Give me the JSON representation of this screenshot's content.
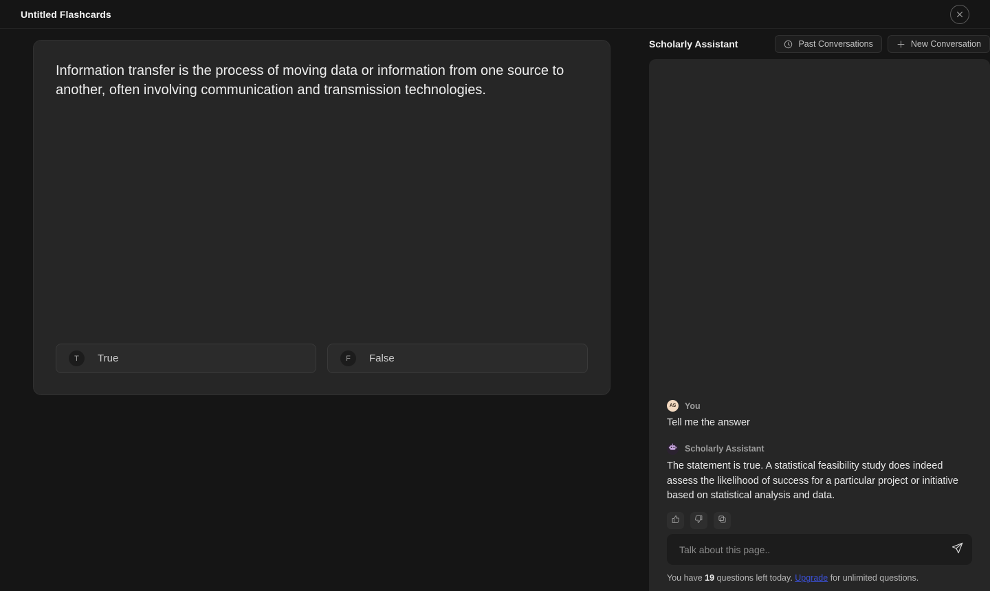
{
  "topbar": {
    "title": "Untitled Flashcards",
    "close_icon": "close-circle-icon"
  },
  "flashcard": {
    "question": "Information transfer is the process of moving data or information from one source to another, often involving communication and transmission technologies.",
    "answers": [
      {
        "key": "T",
        "label": "True"
      },
      {
        "key": "F",
        "label": "False"
      }
    ]
  },
  "chat": {
    "title": "Scholarly Assistant",
    "header_buttons": [
      {
        "label": "Past Conversations",
        "icon": "clock-icon"
      },
      {
        "label": "New Conversation",
        "icon": "plus-icon"
      }
    ],
    "messages": [
      {
        "author": "You",
        "avatar_initials": "AS",
        "avatar_kind": "user",
        "text": "Tell me the answer"
      },
      {
        "author": "Scholarly Assistant",
        "avatar_kind": "bot",
        "avatar_icon": "robot-icon",
        "text": "The statement is true. A statistical feasibility study does indeed assess the likelihood of success for a particular project or initiative based on statistical analysis and data."
      }
    ],
    "feedback_buttons": [
      {
        "icon": "thumbs-up-icon"
      },
      {
        "icon": "thumbs-down-icon"
      },
      {
        "icon": "copy-icon"
      }
    ],
    "composer": {
      "placeholder": "Talk about this page..",
      "value": "",
      "send_icon": "send-icon"
    },
    "quota": {
      "prefix": "You have ",
      "count": "19",
      "middle": " questions left today. ",
      "link": "Upgrade",
      "suffix": " for unlimited questions."
    }
  },
  "colors": {
    "page_background": "#151515",
    "panel_background": "#262626",
    "link": "#3b50d8",
    "user_avatar": "#f3d9c0",
    "bot_avatar_glyph": "#c9a7e0"
  }
}
